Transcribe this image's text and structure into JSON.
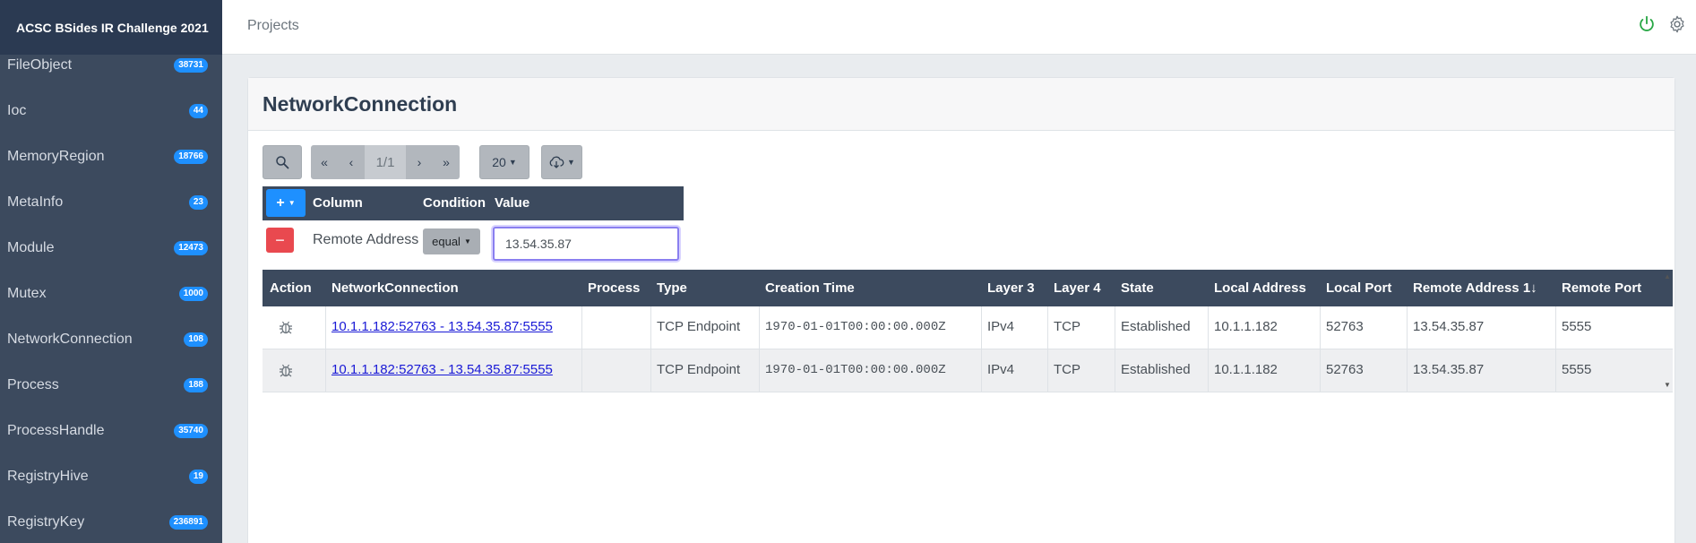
{
  "app": {
    "title": "ACSC BSides IR Challenge 2021"
  },
  "topbar": {
    "breadcrumb": "Projects"
  },
  "sidebar": {
    "items": [
      {
        "label": "FileObject",
        "count": "38731"
      },
      {
        "label": "Ioc",
        "count": "44"
      },
      {
        "label": "MemoryRegion",
        "count": "18766"
      },
      {
        "label": "MetaInfo",
        "count": "23"
      },
      {
        "label": "Module",
        "count": "12473"
      },
      {
        "label": "Mutex",
        "count": "1000"
      },
      {
        "label": "NetworkConnection",
        "count": "108"
      },
      {
        "label": "Process",
        "count": "188"
      },
      {
        "label": "ProcessHandle",
        "count": "35740"
      },
      {
        "label": "RegistryHive",
        "count": "19"
      },
      {
        "label": "RegistryKey",
        "count": "236891"
      }
    ]
  },
  "card": {
    "title": "NetworkConnection"
  },
  "toolbar": {
    "first": "«",
    "prev": "‹",
    "page": "1/1",
    "next": "›",
    "last": "»",
    "page_size": "20"
  },
  "filter": {
    "headers": {
      "column": "Column",
      "condition": "Condition",
      "value": "Value"
    },
    "add_label": "+",
    "remove_label": "−",
    "row": {
      "column": "Remote Address",
      "condition": "equal",
      "value": "13.54.35.87"
    }
  },
  "table": {
    "headers": {
      "action": "Action",
      "conn": "NetworkConnection",
      "process": "Process",
      "type": "Type",
      "ctime": "Creation Time",
      "l3": "Layer 3",
      "l4": "Layer 4",
      "state": "State",
      "laddr": "Local Address",
      "lport": "Local Port",
      "raddr": "Remote Address 1↓",
      "rport": "Remote Port"
    },
    "rows": [
      {
        "conn": "10.1.1.182:52763 - 13.54.35.87:5555",
        "process": "",
        "type": "TCP Endpoint",
        "ctime": "1970-01-01T00:00:00.000Z",
        "l3": "IPv4",
        "l4": "TCP",
        "state": "Established",
        "laddr": "10.1.1.182",
        "lport": "52763",
        "raddr": "13.54.35.87",
        "rport": "5555"
      },
      {
        "conn": "10.1.1.182:52763 - 13.54.35.87:5555",
        "process": "",
        "type": "TCP Endpoint",
        "ctime": "1970-01-01T00:00:00.000Z",
        "l3": "IPv4",
        "l4": "TCP",
        "state": "Established",
        "laddr": "10.1.1.182",
        "lport": "52763",
        "raddr": "13.54.35.87",
        "rport": "5555"
      }
    ]
  },
  "colors": {
    "sidebar": "#3c4a5e",
    "accent": "#1e90ff",
    "danger": "#e9494f",
    "power": "#28a745"
  }
}
